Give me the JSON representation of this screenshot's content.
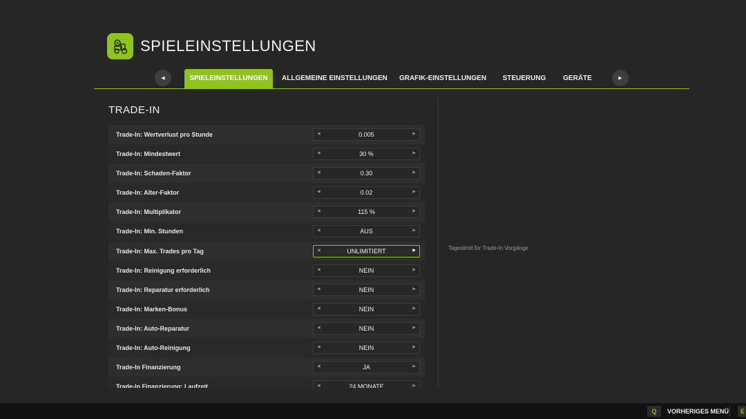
{
  "header": {
    "title": "SPIELEINSTELLUNGEN",
    "logo_icon": "tractor-gear-icon"
  },
  "tabs": [
    {
      "label": "SPIELEINSTELLUNGEN",
      "active": true
    },
    {
      "label": "ALLGEMEINE EINSTELLUNGEN",
      "active": false
    },
    {
      "label": "GRAFIK-EINSTELLUNGEN",
      "active": false
    },
    {
      "label": "STEUERUNG",
      "active": false
    },
    {
      "label": "GERÄTE",
      "active": false
    }
  ],
  "section": {
    "title": "TRADE-IN"
  },
  "settings": [
    {
      "label": "Trade-In: Wertverlust pro Stunde",
      "value": "0.005"
    },
    {
      "label": "Trade-In: Mindestwert",
      "value": "30 %"
    },
    {
      "label": "Trade-In: Schaden-Faktor",
      "value": "0.30"
    },
    {
      "label": "Trade-In: Alter-Faktor",
      "value": "0.02"
    },
    {
      "label": "Trade-In: Multiplikator",
      "value": "115 %"
    },
    {
      "label": "Trade-In: Min. Stunden",
      "value": "AUS"
    },
    {
      "label": "Trade-In: Max. Trades pro Tag",
      "value": "UNLIMITIERT",
      "focused": true
    },
    {
      "label": "Trade-In: Reinigung erforderlich",
      "value": "NEIN"
    },
    {
      "label": "Trade-In: Reparatur erforderlich",
      "value": "NEIN"
    },
    {
      "label": "Trade-In: Marken-Bonus",
      "value": "NEIN"
    },
    {
      "label": "Trade-In: Auto-Reparatur",
      "value": "NEIN"
    },
    {
      "label": "Trade-In: Auto-Reinigung",
      "value": "NEIN"
    },
    {
      "label": "Trade-In Finanzierung",
      "value": "JA"
    },
    {
      "label": "Trade-In Finanzierung: Laufzeit",
      "value": "24 MONATE"
    }
  ],
  "help_text": "Tageslimit für Trade-In Vorgänge",
  "bottom": {
    "back_key": "Q",
    "back_label": "VORHERIGES MENÜ",
    "next_key": "E"
  },
  "colors": {
    "accent": "#8fc31f",
    "background": "#262626"
  }
}
